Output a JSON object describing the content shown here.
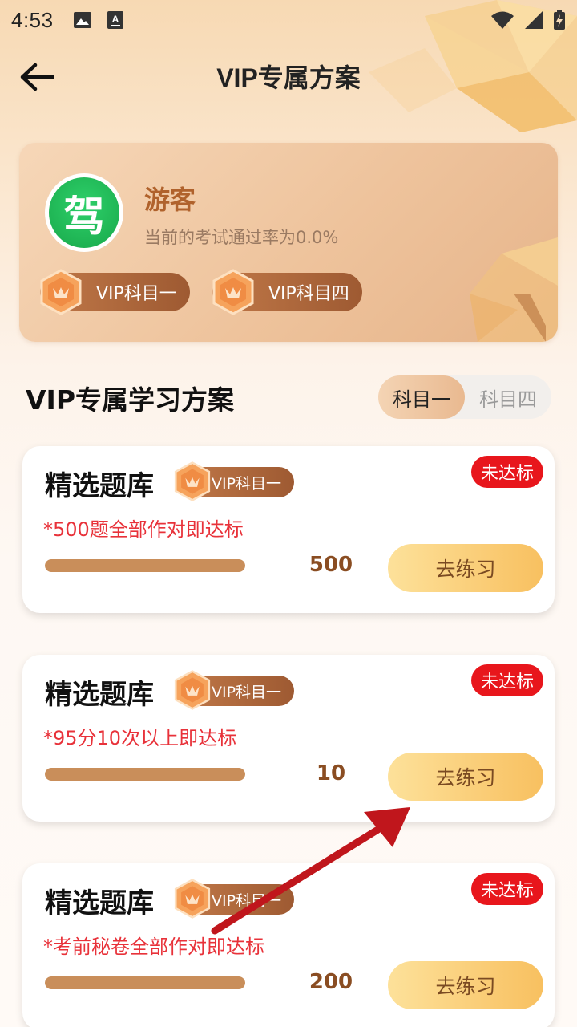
{
  "status_bar": {
    "time": "4:53"
  },
  "nav": {
    "title": "VIP专属方案"
  },
  "user": {
    "avatar_char": "驾",
    "name": "游客",
    "pass_rate_text": "当前的考试通过率为0.0%",
    "badges": [
      "VIP科目一",
      "VIP科目四"
    ]
  },
  "section": {
    "title": "VIP专属学习方案",
    "tabs": [
      {
        "label": "科目一",
        "active": true
      },
      {
        "label": "科目四",
        "active": false
      }
    ]
  },
  "tasks": [
    {
      "title": "精选题库",
      "vip_label": "VIP科目一",
      "status": "未达标",
      "desc": "*500题全部作对即达标",
      "count": "500",
      "progress": 1.0,
      "button": "去练习"
    },
    {
      "title": "精选题库",
      "vip_label": "VIP科目一",
      "status": "未达标",
      "desc": "*95分10次以上即达标",
      "count": "10",
      "progress": 1.0,
      "button": "去练习"
    },
    {
      "title": "精选题库",
      "vip_label": "VIP科目一",
      "status": "未达标",
      "desc": "*考前秘卷全部作对即达标",
      "count": "200",
      "progress": 1.0,
      "button": "去练习"
    }
  ],
  "colors": {
    "accent_brown": "#9e5a32",
    "status_red": "#e8161c",
    "button_gold": "#f8c060",
    "annotation_red": "#c0161c"
  }
}
